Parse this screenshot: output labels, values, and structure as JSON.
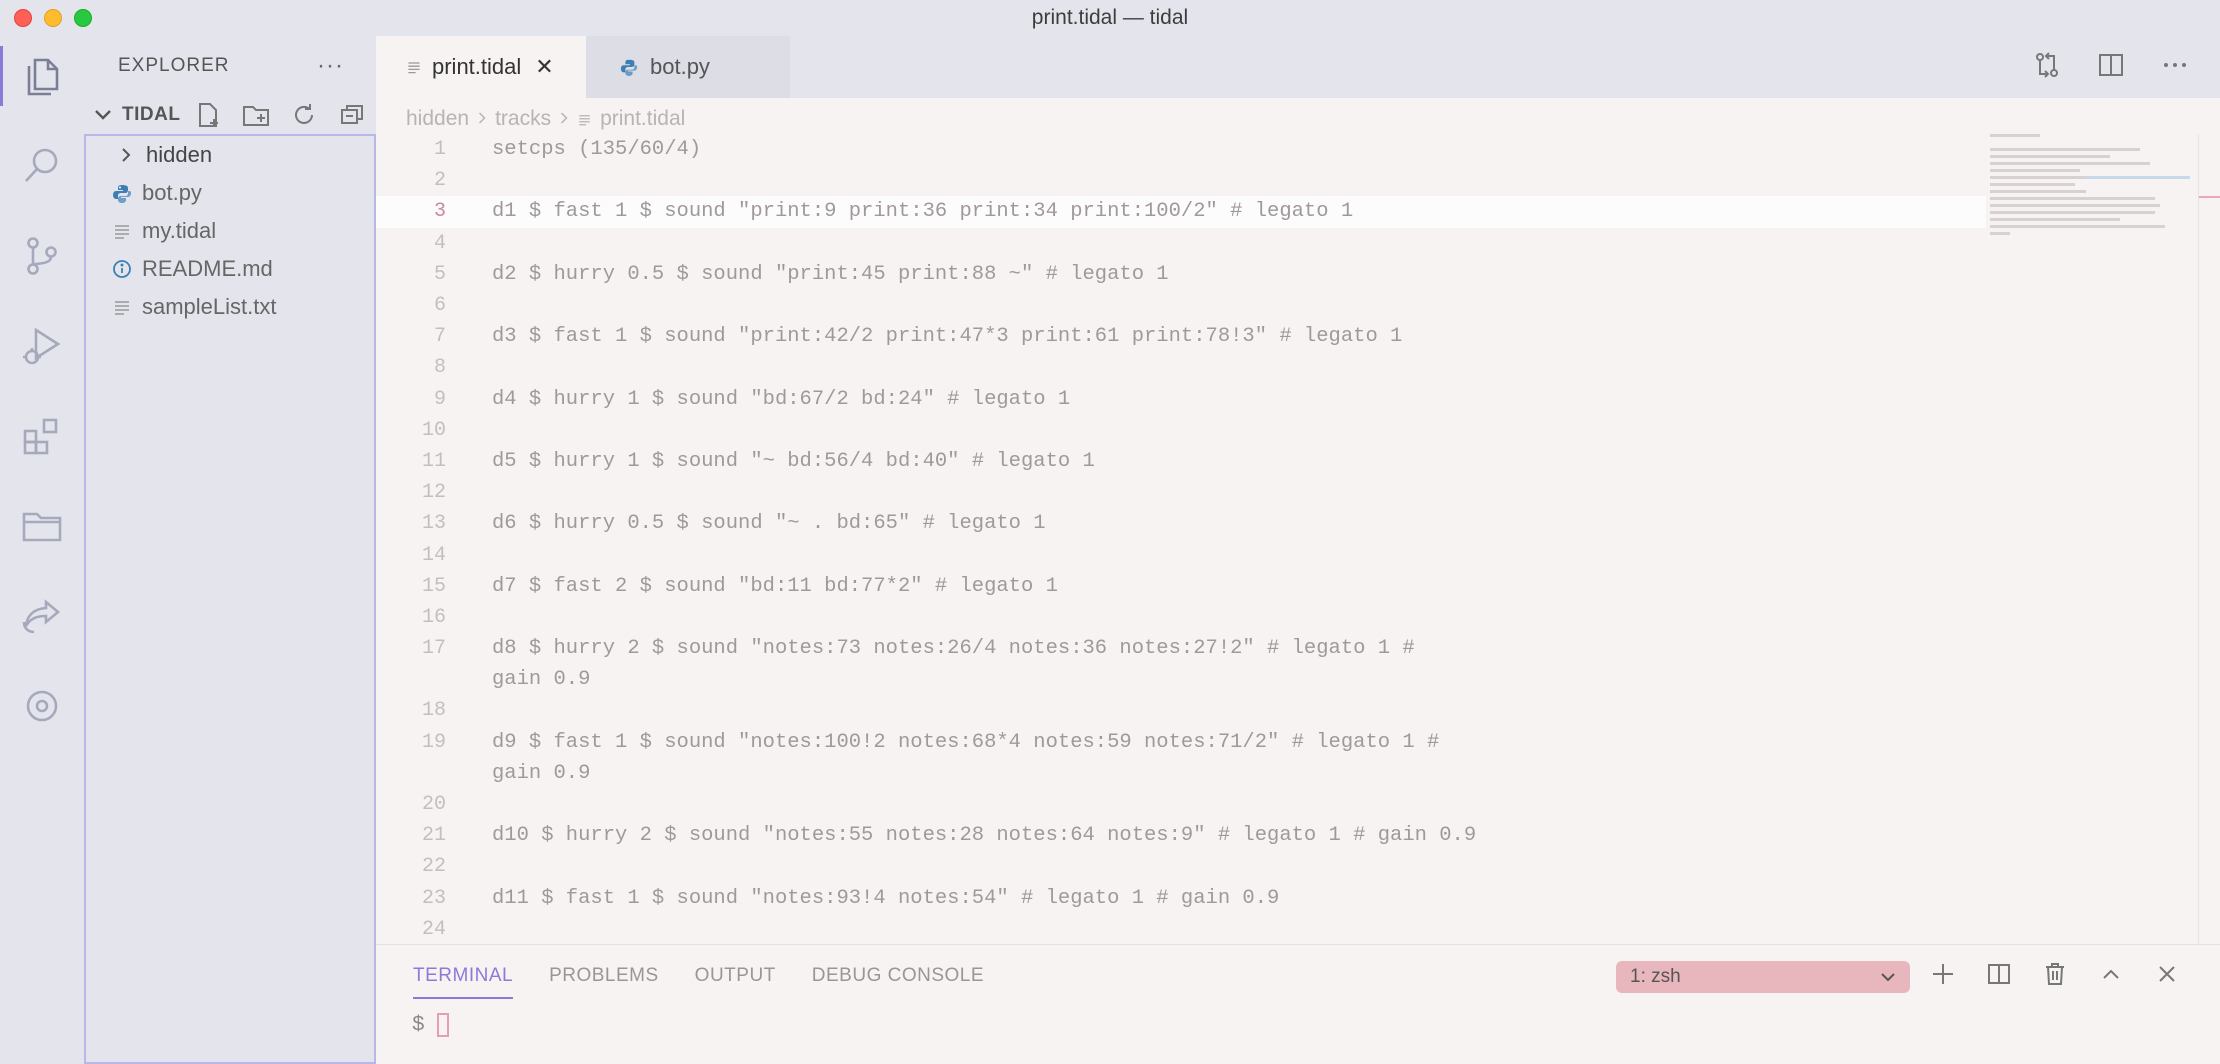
{
  "window": {
    "title": "print.tidal — tidal"
  },
  "activity_bar": {
    "items": [
      {
        "name": "explorer",
        "icon": "files-icon",
        "active": true
      },
      {
        "name": "search",
        "icon": "search-icon"
      },
      {
        "name": "source-control",
        "icon": "source-control-icon"
      },
      {
        "name": "run-debug",
        "icon": "run-debug-icon"
      },
      {
        "name": "extensions",
        "icon": "extensions-icon"
      },
      {
        "name": "folder",
        "icon": "folder-icon"
      },
      {
        "name": "live-share",
        "icon": "live-share-icon"
      },
      {
        "name": "disc",
        "icon": "disc-icon"
      }
    ]
  },
  "sidebar": {
    "title": "EXPLORER",
    "more": "···",
    "section": "TIDAL",
    "items": [
      {
        "label": "hidden",
        "type": "folder"
      },
      {
        "label": "bot.py",
        "type": "python"
      },
      {
        "label": "my.tidal",
        "type": "text"
      },
      {
        "label": "README.md",
        "type": "info"
      },
      {
        "label": "sampleList.txt",
        "type": "text"
      }
    ]
  },
  "tabs": [
    {
      "label": "print.tidal",
      "active": true,
      "close": "✕"
    },
    {
      "label": "bot.py",
      "active": false
    }
  ],
  "breadcrumb": {
    "parts": [
      "hidden",
      "tracks",
      "print.tidal"
    ]
  },
  "editor": {
    "current_line": 3,
    "lines": [
      {
        "n": "1",
        "text": "setcps (135/60/4)"
      },
      {
        "n": "2",
        "text": ""
      },
      {
        "n": "3",
        "text": "d1 $ fast 1 $ sound \"print:9 print:36 print:34 print:100/2\" # legato 1"
      },
      {
        "n": "4",
        "text": ""
      },
      {
        "n": "5",
        "text": "d2 $ hurry 0.5 $ sound \"print:45 print:88 ~\" # legato 1"
      },
      {
        "n": "6",
        "text": ""
      },
      {
        "n": "7",
        "text": "d3 $ fast 1 $ sound \"print:42/2 print:47*3 print:61 print:78!3\" # legato 1"
      },
      {
        "n": "8",
        "text": ""
      },
      {
        "n": "9",
        "text": "d4 $ hurry 1 $ sound \"bd:67/2 bd:24\" # legato 1"
      },
      {
        "n": "10",
        "text": ""
      },
      {
        "n": "11",
        "text": "d5 $ hurry 1 $ sound \"~ bd:56/4 bd:40\" # legato 1"
      },
      {
        "n": "12",
        "text": ""
      },
      {
        "n": "13",
        "text": "d6 $ hurry 0.5 $ sound \"~ . bd:65\" # legato 1"
      },
      {
        "n": "14",
        "text": ""
      },
      {
        "n": "15",
        "text": "d7 $ fast 2 $ sound \"bd:11 bd:77*2\" # legato 1"
      },
      {
        "n": "16",
        "text": ""
      },
      {
        "n": "17",
        "text": "d8 $ hurry 2 $ sound \"notes:73 notes:26/4 notes:36 notes:27!2\" # legato 1 #"
      },
      {
        "n": "",
        "text": "gain 0.9"
      },
      {
        "n": "18",
        "text": ""
      },
      {
        "n": "19",
        "text": "d9 $ fast 1 $ sound \"notes:100!2 notes:68*4 notes:59 notes:71/2\" # legato 1 #"
      },
      {
        "n": "",
        "text": "gain 0.9"
      },
      {
        "n": "20",
        "text": ""
      },
      {
        "n": "21",
        "text": "d10 $ hurry 2 $ sound \"notes:55 notes:28 notes:64 notes:9\" # legato 1 # gain 0.9"
      },
      {
        "n": "22",
        "text": ""
      },
      {
        "n": "23",
        "text": "d11 $ fast 1 $ sound \"notes:93!4 notes:54\" # legato 1 # gain 0.9"
      },
      {
        "n": "24",
        "text": ""
      }
    ]
  },
  "panel": {
    "tabs": [
      {
        "label": "TERMINAL",
        "active": true
      },
      {
        "label": "PROBLEMS"
      },
      {
        "label": "OUTPUT"
      },
      {
        "label": "DEBUG CONSOLE"
      }
    ],
    "terminal_select": "1: zsh",
    "prompt": "$"
  },
  "colors": {
    "accent": "#8b7bd8",
    "terminal_select_bg": "#e8b6bd",
    "background": "#f7f3f2",
    "chrome": "#e4e5ec"
  }
}
